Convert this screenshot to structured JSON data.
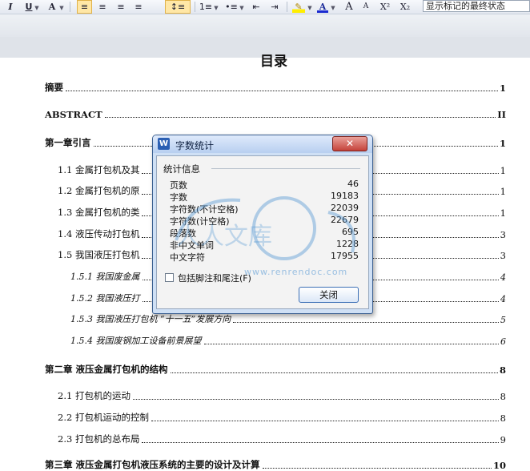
{
  "toolbar": {
    "items": [
      {
        "name": "italic-button",
        "glyph": "I"
      },
      {
        "name": "underline-button",
        "glyph": "U"
      },
      {
        "name": "font-color-a-button",
        "glyph": "A"
      },
      {
        "name": "align-left-button",
        "glyph": "≡"
      },
      {
        "name": "align-center-button",
        "glyph": "≡"
      },
      {
        "name": "align-right-button",
        "glyph": "≡"
      },
      {
        "name": "justify-button",
        "glyph": "≡"
      },
      {
        "name": "line-spacing-button",
        "glyph": "↕≡"
      },
      {
        "name": "numbered-list-button",
        "glyph": "1≡"
      },
      {
        "name": "bullet-list-button",
        "glyph": "•≡"
      },
      {
        "name": "decrease-indent-button",
        "glyph": "⇤"
      },
      {
        "name": "increase-indent-button",
        "glyph": "⇥"
      },
      {
        "name": "highlight-button",
        "glyph": "✎"
      },
      {
        "name": "font-color-button",
        "glyph": "A"
      },
      {
        "name": "grow-font-button",
        "glyph": "A"
      },
      {
        "name": "shrink-font-button",
        "glyph": "A"
      },
      {
        "name": "superscript-button",
        "glyph": "X²"
      },
      {
        "name": "subscript-button",
        "glyph": "X₂"
      }
    ],
    "track_changes_view": "显示标记的最终状态"
  },
  "document": {
    "title": "目录",
    "toc": [
      {
        "text": "摘要",
        "page": "1",
        "level": 0
      },
      {
        "text": "ABSTRACT",
        "page": "II",
        "level": 0
      },
      {
        "text": "第一章引言",
        "page": "1",
        "level": 0
      },
      {
        "text": "1.1  金属打包机及其",
        "page": "1",
        "level": 1
      },
      {
        "text": "1.2  金属打包机的原",
        "page": "1",
        "level": 1
      },
      {
        "text": "1.3  金属打包机的类",
        "page": "1",
        "level": 1
      },
      {
        "text": "1.4  液压传动打包机",
        "page": "3",
        "level": 1
      },
      {
        "text": "1.5  我国液压打包机",
        "page": "3",
        "level": 1
      },
      {
        "text": "1.5.1  我国废金属",
        "page": "4",
        "level": 2
      },
      {
        "text": "1.5.2  我国液压打",
        "page": "4",
        "level": 2
      },
      {
        "text": "1.5.3  我国液压打包机 “十一五”发展方向",
        "page": "5",
        "level": 2
      },
      {
        "text": "1.5.4  我国废钢加工设备前景展望",
        "page": "6",
        "level": 2
      },
      {
        "text": "第二章  液压金属打包机的结构",
        "page": "8",
        "level": 0
      },
      {
        "text": "2.1  打包机的运动",
        "page": "8",
        "level": 1
      },
      {
        "text": "2.2  打包机运动的控制",
        "page": "8",
        "level": 1
      },
      {
        "text": "2.3  打包机的总布局",
        "page": "9",
        "level": 1
      },
      {
        "text": "第三章  液压金属打包机液压系统的主要的设计及计算",
        "page": "10",
        "level": 0
      }
    ]
  },
  "dialog": {
    "app_icon": "W",
    "title": "字数统计",
    "close_glyph": "✕",
    "group_title": "统计信息",
    "stats": [
      {
        "label": "页数",
        "value": "46"
      },
      {
        "label": "字数",
        "value": "19183"
      },
      {
        "label": "字符数(不计空格)",
        "value": "22039"
      },
      {
        "label": "字符数(计空格)",
        "value": "22679"
      },
      {
        "label": "段落数",
        "value": "695"
      },
      {
        "label": "非中文单词",
        "value": "1228"
      },
      {
        "label": "中文字符",
        "value": "17955"
      }
    ],
    "include_notes_label": "包括脚注和尾注(F)",
    "include_notes_checked": false,
    "close_button_label": "关闭"
  },
  "watermark": {
    "text": "人人文库",
    "url": "www.renrendoc.com",
    "color": "#5b9bd5"
  }
}
